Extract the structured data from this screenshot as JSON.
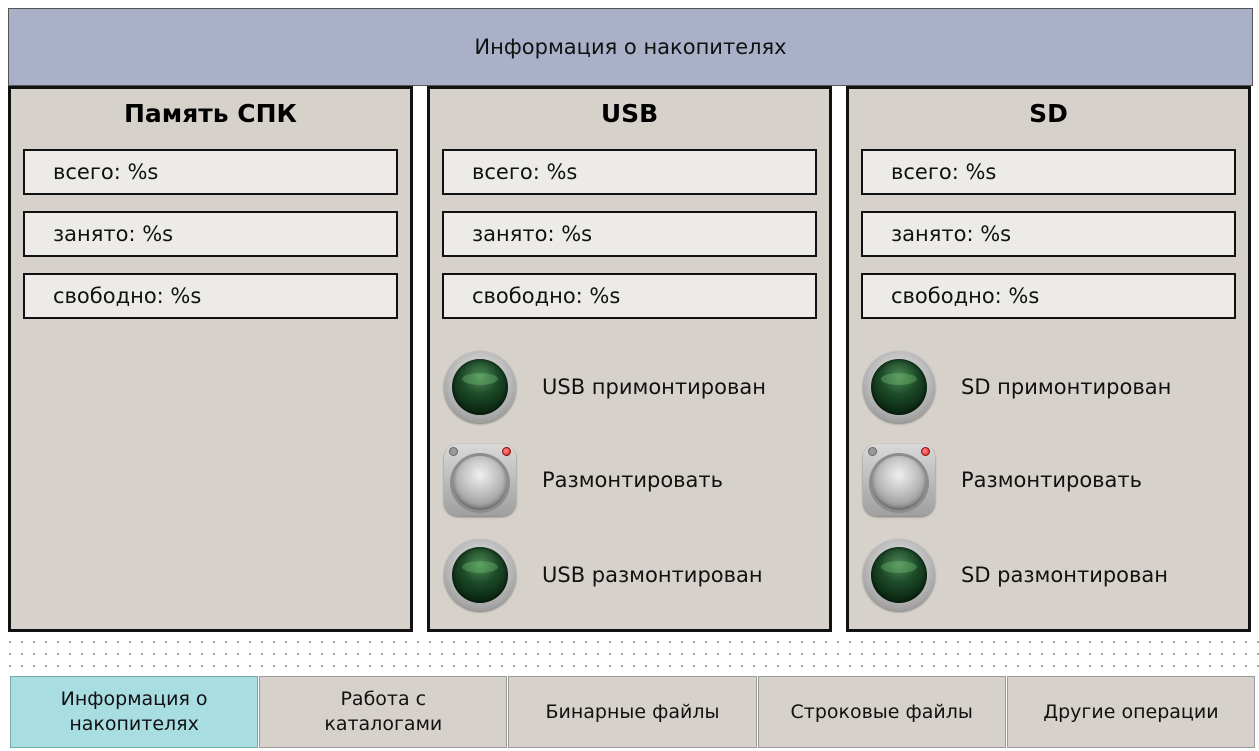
{
  "header": {
    "title": "Информация о накопителях"
  },
  "panels": {
    "spk": {
      "title": "Память СПК",
      "total": "всего: %s",
      "used": "занято: %s",
      "free": "свободно: %s"
    },
    "usb": {
      "title": "USB",
      "total": "всего: %s",
      "used": "занято: %s",
      "free": "свободно: %s",
      "mounted_label": "USB примонтирован",
      "unmount_label": "Размонтировать",
      "unmounted_label": "USB размонтирован"
    },
    "sd": {
      "title": "SD",
      "total": "всего: %s",
      "used": "занято: %s",
      "free": "свободно: %s",
      "mounted_label": "SD примонтирован",
      "unmount_label": "Размонтировать",
      "unmounted_label": "SD размонтирован"
    }
  },
  "tabs": [
    {
      "label": "Информация о\nнакопителях",
      "active": true
    },
    {
      "label": "Работа с\nкаталогами",
      "active": false
    },
    {
      "label": "Бинарные файлы",
      "active": false
    },
    {
      "label": "Строковые файлы",
      "active": false
    },
    {
      "label": "Другие операции",
      "active": false
    }
  ],
  "colors": {
    "header_bg": "#aab0c8",
    "panel_bg": "#d6d2cb",
    "active_tab": "#a8dde2",
    "indicator_off": "#0c2a14"
  }
}
